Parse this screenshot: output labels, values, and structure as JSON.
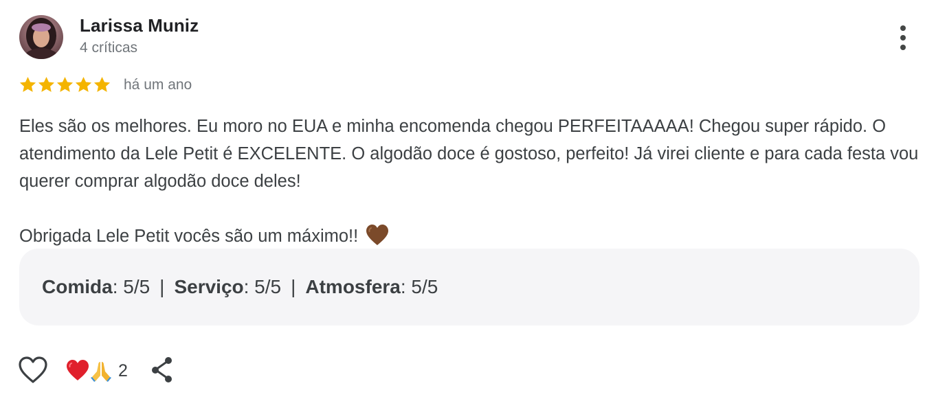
{
  "review": {
    "author_name": "Larissa Muniz",
    "author_meta": "4 críticas",
    "rating": 5,
    "rating_max": 5,
    "date": "há um ano",
    "paragraphs": [
      "Eles são os melhores. Eu moro no EUA e minha encomenda chegou PERFEITAAAAA! Chegou super rápido. O atendimento da Lele Petit é EXCELENTE. O algodão doce é gostoso, perfeito! Já virei cliente e para cada festa vou querer comprar algodão doce deles!",
      "Obrigada Lele Petit vocês são um máximo!!"
    ],
    "trailing_emoji_icon": "brown-heart-icon"
  },
  "ratings": {
    "food_label": "Comida",
    "food_value": ": 5/5",
    "service_label": "Serviço",
    "service_value": ": 5/5",
    "atmosphere_label": "Atmosfera",
    "atmosphere_value": ": 5/5",
    "separator": "|"
  },
  "actions": {
    "like_icon": "heart-outline-icon",
    "reaction_icons": [
      "red-heart-icon",
      "folded-hands-icon"
    ],
    "reaction_count": "2",
    "share_icon": "share-icon",
    "more_icon": "more-vertical-icon"
  },
  "colors": {
    "star": "#f4b400",
    "text": "#3c4043",
    "name": "#202124",
    "meta": "#70757a",
    "ratings_bg": "#f5f5f7"
  }
}
